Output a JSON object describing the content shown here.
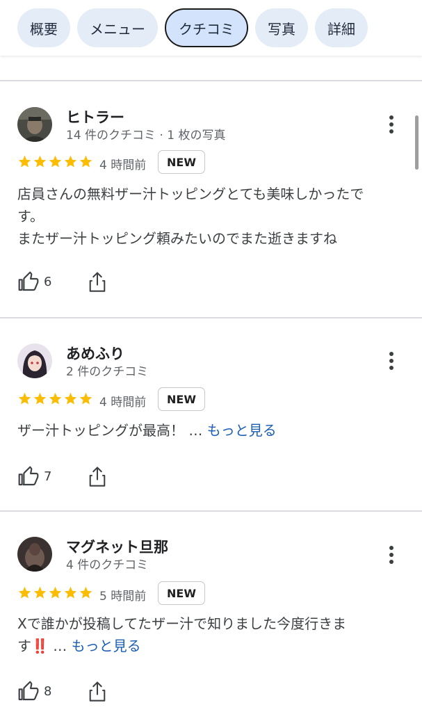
{
  "tabs": [
    {
      "label": "概要"
    },
    {
      "label": "メニュー"
    },
    {
      "label": "クチコミ"
    },
    {
      "label": "写真"
    },
    {
      "label": "詳細"
    }
  ],
  "reviews": [
    {
      "name": "ヒトラー",
      "meta": "14 件のクチコミ · 1 枚の写真",
      "rating": 5,
      "time": "4 時間前",
      "badge": "NEW",
      "text_lines": [
        "店員さんの無料ザー汁トッピングとても美味しかったで",
        "す。",
        "またザー汁トッピング頼みたいのでまた逝きますね"
      ],
      "likes": "6"
    },
    {
      "name": "あめふり",
      "meta": "2 件のクチコミ",
      "rating": 5,
      "time": "4 時間前",
      "badge": "NEW",
      "text_lines": [
        "ザー汁トッピングが最高！ … "
      ],
      "more_label": "もっと見る",
      "likes": "7"
    },
    {
      "name": "マグネット旦那",
      "meta": "4 件のクチコミ",
      "rating": 5,
      "time": "5 時間前",
      "badge": "NEW",
      "text_lines": [
        "Xで誰かが投稿してたザー汁で知りました今度行きま",
        "す"
      ],
      "emoji": "‼️",
      "ellipsis": " … ",
      "more_label": "もっと見る",
      "likes": "8"
    }
  ],
  "colors": {
    "star": "#fbbc04",
    "link": "#1a5fb4",
    "tab_bg": "#e4ecf8",
    "tab_active_bg": "#d4e3fc"
  },
  "icons": [
    "more-vert-icon",
    "star-icon",
    "thumbs-up-icon",
    "share-icon"
  ]
}
